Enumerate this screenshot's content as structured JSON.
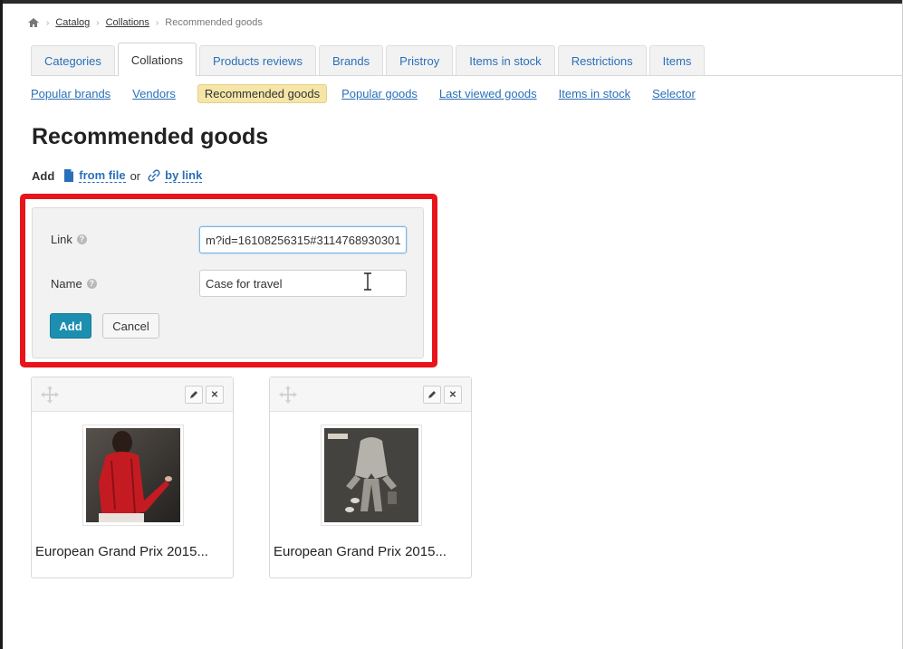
{
  "breadcrumb": {
    "home_icon": "home-icon",
    "items": [
      "Catalog",
      "Collations",
      "Recommended goods"
    ]
  },
  "tabs": [
    "Categories",
    "Collations",
    "Products reviews",
    "Brands",
    "Pristroy",
    "Items in stock",
    "Restrictions",
    "Items"
  ],
  "active_tab": "Collations",
  "subnav": [
    "Popular brands",
    "Vendors",
    "Recommended goods",
    "Popular goods",
    "Last viewed goods",
    "Items in stock",
    "Selector"
  ],
  "active_subnav": "Recommended goods",
  "page": {
    "title": "Recommended goods"
  },
  "add_line": {
    "label": "Add",
    "from_file": "from file",
    "or": "or",
    "by_link": "by link"
  },
  "form": {
    "link_label": "Link",
    "link_value": "m?id=16108256315#3114768930301",
    "name_label": "Name",
    "name_value": "Case for travel",
    "add_button": "Add",
    "cancel_button": "Cancel"
  },
  "colors": {
    "accent": "#1c8fb0",
    "link": "#2a6fb8",
    "highlight": "#e8141b",
    "active_subnav": "#f5e6a8"
  },
  "cards": [
    {
      "title": "European Grand Prix 2015...",
      "image": "red-jacket-photo"
    },
    {
      "title": "European Grand Prix 2015...",
      "image": "grey-outfit-photo"
    }
  ]
}
